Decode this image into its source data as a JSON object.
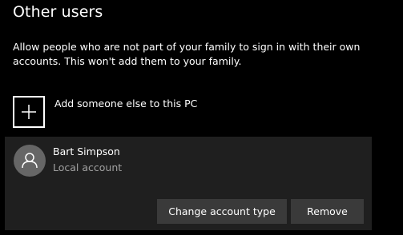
{
  "section": {
    "title": "Other users",
    "description": "Allow people who are not part of your family to sign in with their own accounts. This won't add them to your family."
  },
  "add_user": {
    "label": "Add someone else to this PC",
    "icon": "plus-icon"
  },
  "account": {
    "name": "Bart Simpson",
    "type": "Local account",
    "avatar_icon": "person-icon",
    "buttons": {
      "change_type": "Change account type",
      "remove": "Remove"
    }
  },
  "colors": {
    "background": "#000000",
    "panel": "#1f1f1f",
    "button": "#3a3a3a",
    "avatar": "#666666",
    "secondary_text": "#a0a0a0"
  }
}
